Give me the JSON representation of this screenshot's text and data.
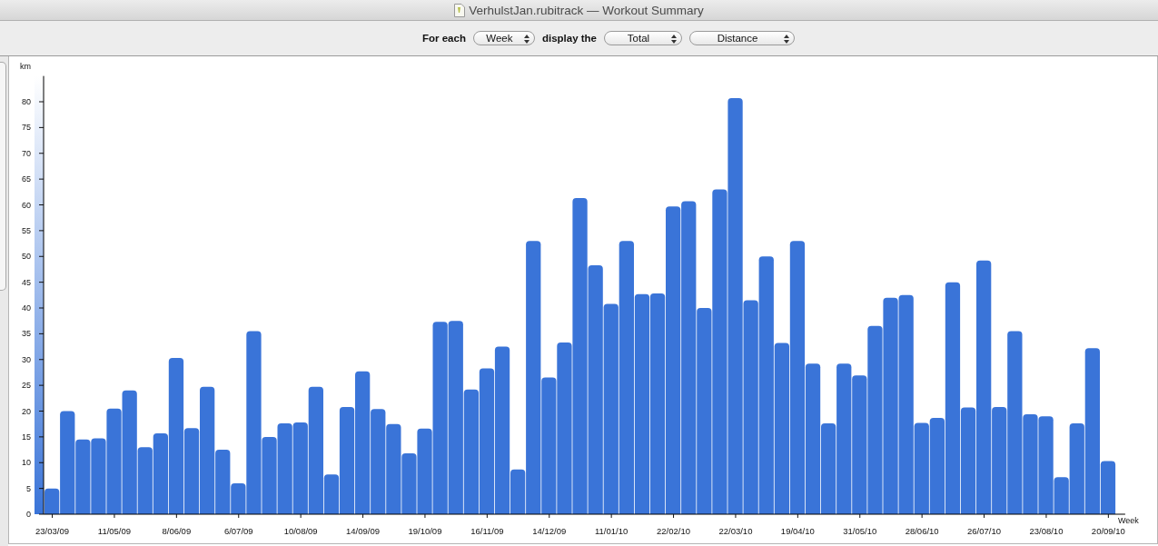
{
  "window": {
    "title": "VerhulstJan.rubitrack — Workout Summary"
  },
  "toolbar": {
    "for_each_label": "For each",
    "period": "Week",
    "display_label": "display the",
    "aggregate": "Total",
    "metric": "Distance"
  },
  "chart": {
    "chart_data": {
      "type": "bar",
      "ylabel": "km",
      "xlabel": "Week",
      "ylim": [
        0,
        85
      ],
      "yticks": [
        0,
        5,
        10,
        15,
        20,
        25,
        30,
        35,
        40,
        45,
        50,
        55,
        60,
        65,
        70,
        75,
        80
      ],
      "categories": [
        "23/03/09",
        null,
        null,
        null,
        "11/05/09",
        null,
        null,
        null,
        "8/06/09",
        null,
        null,
        null,
        "6/07/09",
        null,
        null,
        null,
        "10/08/09",
        null,
        null,
        null,
        "14/09/09",
        null,
        null,
        null,
        "19/10/09",
        null,
        null,
        null,
        "16/11/09",
        null,
        null,
        null,
        "14/12/09",
        null,
        null,
        null,
        "11/01/10",
        null,
        null,
        null,
        "22/02/10",
        null,
        null,
        null,
        "22/03/10",
        null,
        null,
        null,
        "19/04/10",
        null,
        null,
        null,
        "31/05/10",
        null,
        null,
        null,
        "28/06/10",
        null,
        null,
        null,
        "26/07/10",
        null,
        null,
        null,
        "23/08/10",
        null,
        null,
        null,
        "20/09/10"
      ],
      "series": [
        {
          "color": "#3a74d8",
          "values": [
            5,
            20,
            14.5,
            14.7,
            20.5,
            24,
            13,
            15.7,
            30.3,
            16.7,
            24.7,
            12.5,
            6,
            35.5,
            15,
            17.6,
            17.8,
            24.7,
            7.7,
            20.8,
            27.7,
            20.4,
            17.5,
            11.8,
            16.6,
            37.3,
            37.5,
            24.2,
            28.3,
            32.5,
            8.7,
            53,
            26.5,
            33.3,
            61.3,
            48.3,
            40.8,
            53,
            42.7,
            42.8,
            59.7,
            60.7,
            40,
            63,
            80.7,
            41.5,
            50,
            33.2,
            53,
            29.2,
            17.6,
            29.2,
            26.9,
            36.5,
            42,
            42.5,
            17.7,
            18.7,
            45,
            20.7,
            49.2,
            20.8,
            35.5,
            19.4,
            19,
            7.2,
            17.6,
            32.2,
            10.3
          ]
        }
      ]
    }
  }
}
